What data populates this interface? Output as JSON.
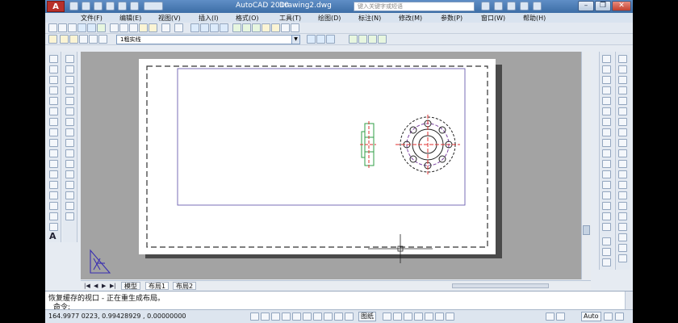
{
  "window": {
    "app_name": "AutoCAD 2010",
    "doc_name": "Drawing2.dwg",
    "search_placeholder": "键入关键字或短语",
    "minimize": "–",
    "restore": "❐",
    "close": "✕"
  },
  "menu": [
    "文件(F)",
    "编辑(E)",
    "视图(V)",
    "插入(I)",
    "格式(O)",
    "工具(T)",
    "绘图(D)",
    "标注(N)",
    "修改(M)",
    "参数(P)",
    "窗口(W)",
    "帮助(H)"
  ],
  "layer_combo": {
    "value": "1粗实线"
  },
  "layout_tabs": {
    "nav": [
      "|◀",
      "◀",
      "▶",
      "▶|"
    ],
    "model": "模型",
    "layout1": "布局1",
    "layout2": "布局2"
  },
  "command": {
    "history": "恢复缓存的视口 - 正在重生成布局。",
    "prompt": "命令:"
  },
  "status": {
    "coords": "164.9977 0223,  0.99428929  ,  0.00000000",
    "paper": "图纸",
    "annotation_scale": "Auto"
  },
  "colors": {
    "workspace": "#a3a3a3",
    "paper": "#ffffff",
    "viewport_border": "#6a5fb0",
    "drawing_red": "#e03030",
    "drawing_green": "#2f9e44",
    "drawing_purple": "#7a3fa0"
  }
}
